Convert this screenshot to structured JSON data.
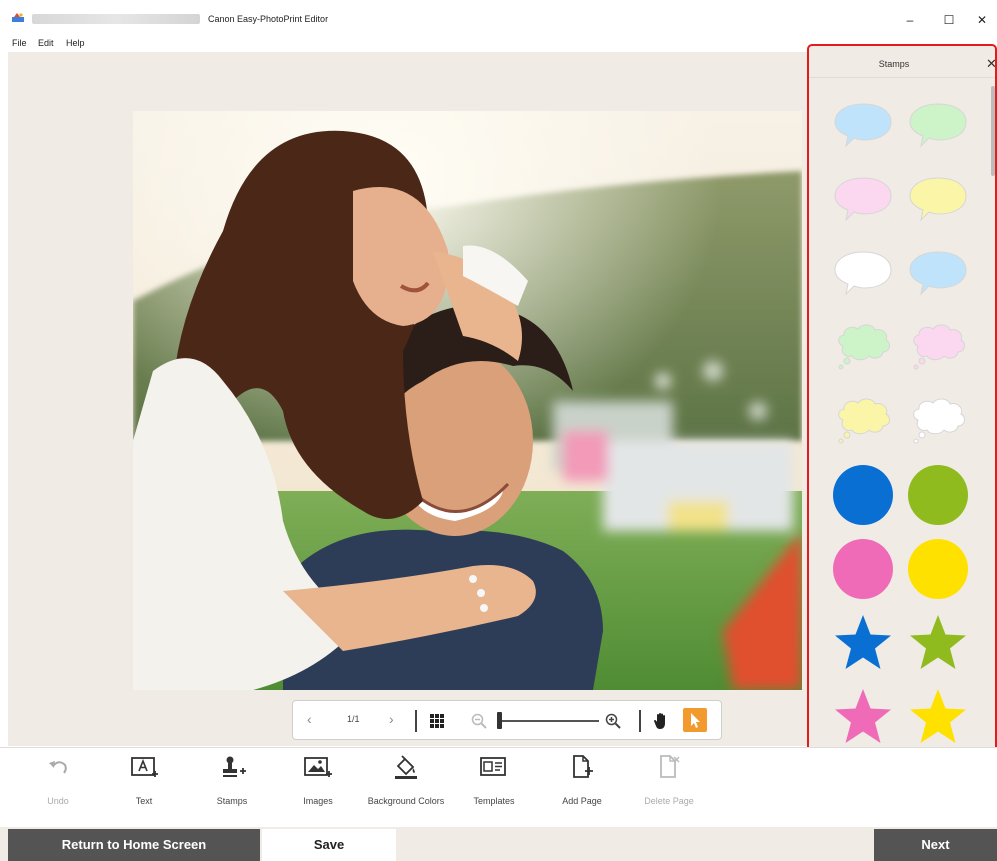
{
  "window": {
    "title": "Canon Easy-PhotoPrint Editor",
    "minimize_glyph": "–",
    "maximize_glyph": "☐",
    "close_glyph": "✕"
  },
  "menu": [
    "File",
    "Edit",
    "Help"
  ],
  "zoom_bar": {
    "prev_glyph": "‹",
    "next_glyph": "›",
    "page_indicator": "1/1",
    "zoom_level": 0.02
  },
  "stamps_panel": {
    "title": "Stamps",
    "close_glyph": "✕",
    "items": [
      {
        "shape": "speech-bubble",
        "color": "#bfe3fb"
      },
      {
        "shape": "speech-bubble",
        "color": "#cdf3c9"
      },
      {
        "shape": "speech-bubble",
        "color": "#fbd8ef"
      },
      {
        "shape": "speech-bubble",
        "color": "#fbf6a7"
      },
      {
        "shape": "speech-bubble",
        "color": "#ffffff"
      },
      {
        "shape": "speech-bubble",
        "color": "#bfe3fb"
      },
      {
        "shape": "thought-bubble",
        "color": "#cdf3c9"
      },
      {
        "shape": "thought-bubble",
        "color": "#fbd8ef"
      },
      {
        "shape": "thought-bubble",
        "color": "#fbf6a7"
      },
      {
        "shape": "thought-bubble",
        "color": "#ffffff"
      },
      {
        "shape": "circle",
        "color": "#0a6fd3"
      },
      {
        "shape": "circle",
        "color": "#8fbb1f"
      },
      {
        "shape": "circle",
        "color": "#f06bb7"
      },
      {
        "shape": "circle",
        "color": "#ffe100"
      },
      {
        "shape": "star",
        "color": "#0a6fd3"
      },
      {
        "shape": "star",
        "color": "#8fbb1f"
      },
      {
        "shape": "star",
        "color": "#f06bb7"
      },
      {
        "shape": "star",
        "color": "#ffe100"
      }
    ]
  },
  "toolbar": {
    "undo": "Undo",
    "text": "Text",
    "stamps": "Stamps",
    "images": "Images",
    "background_colors": "Background Colors",
    "templates": "Templates",
    "add_page": "Add Page",
    "delete_page": "Delete Page"
  },
  "footer": {
    "return_home": "Return to Home Screen",
    "save": "Save",
    "next": "Next"
  },
  "colors": {
    "accent": "#f39a2e",
    "panel_highlight": "#e31b1b",
    "workspace_bg": "#f0ebe5",
    "dark_button": "#545454"
  }
}
